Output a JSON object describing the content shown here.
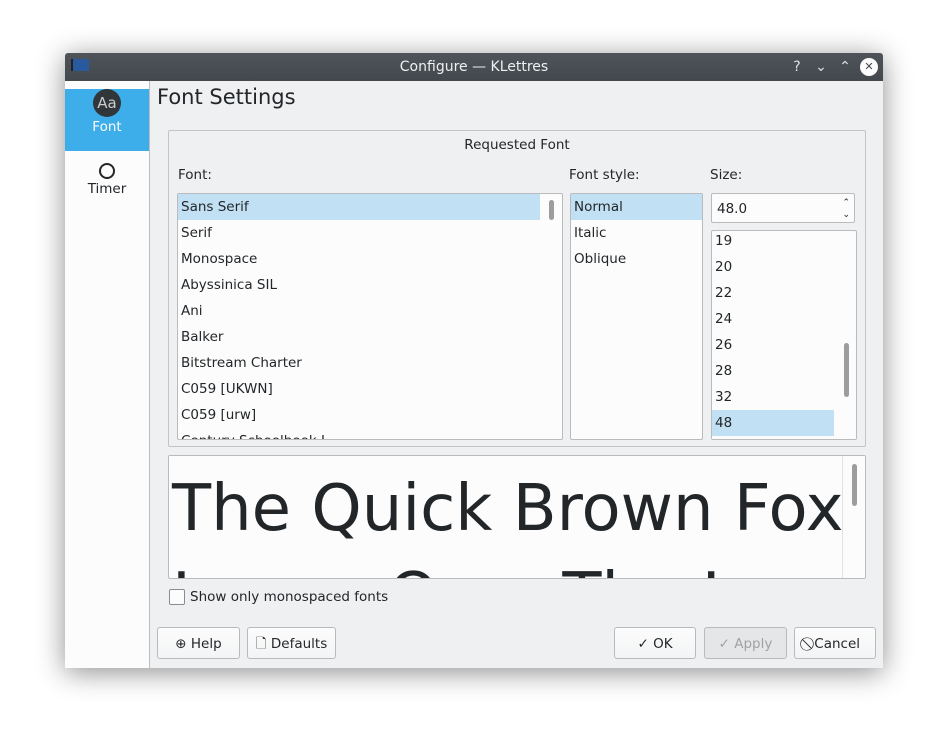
{
  "window": {
    "title": "Configure — KLettres",
    "help": "?",
    "minimize": "⌄",
    "maximize": "⌃",
    "close": "✕"
  },
  "sidebar": {
    "items": [
      {
        "label": "Font",
        "icon": "Aa"
      },
      {
        "label": "Timer",
        "icon": "timer-icon"
      }
    ]
  },
  "page_title": "Font Settings",
  "group": {
    "title": "Requested Font",
    "font_label": "Font:",
    "fonts": [
      "Sans Serif",
      "Serif",
      "Monospace",
      "Abyssinica SIL",
      "Ani",
      "Balker",
      "Bitstream Charter",
      "C059 [UKWN]",
      "C059 [urw]",
      "Century Schoolbook L"
    ],
    "style_label": "Font style:",
    "styles": [
      "Normal",
      "Italic",
      "Oblique"
    ],
    "size_label": "Size:",
    "size_value": "48.0",
    "sizes": [
      "19",
      "20",
      "22",
      "24",
      "26",
      "28",
      "32",
      "48"
    ]
  },
  "preview": {
    "line1": "The Quick Brown Fox",
    "line2": "Jumps Over The Lazy Dog"
  },
  "monospace_checkbox": {
    "label": "Show only monospaced fonts",
    "checked": false
  },
  "buttons": {
    "help": "Help",
    "defaults": "Defaults",
    "ok": "OK",
    "apply": "Apply",
    "cancel": "Cancel"
  },
  "colors": {
    "accent": "#3daee9",
    "selection": "#c2e0f4"
  }
}
